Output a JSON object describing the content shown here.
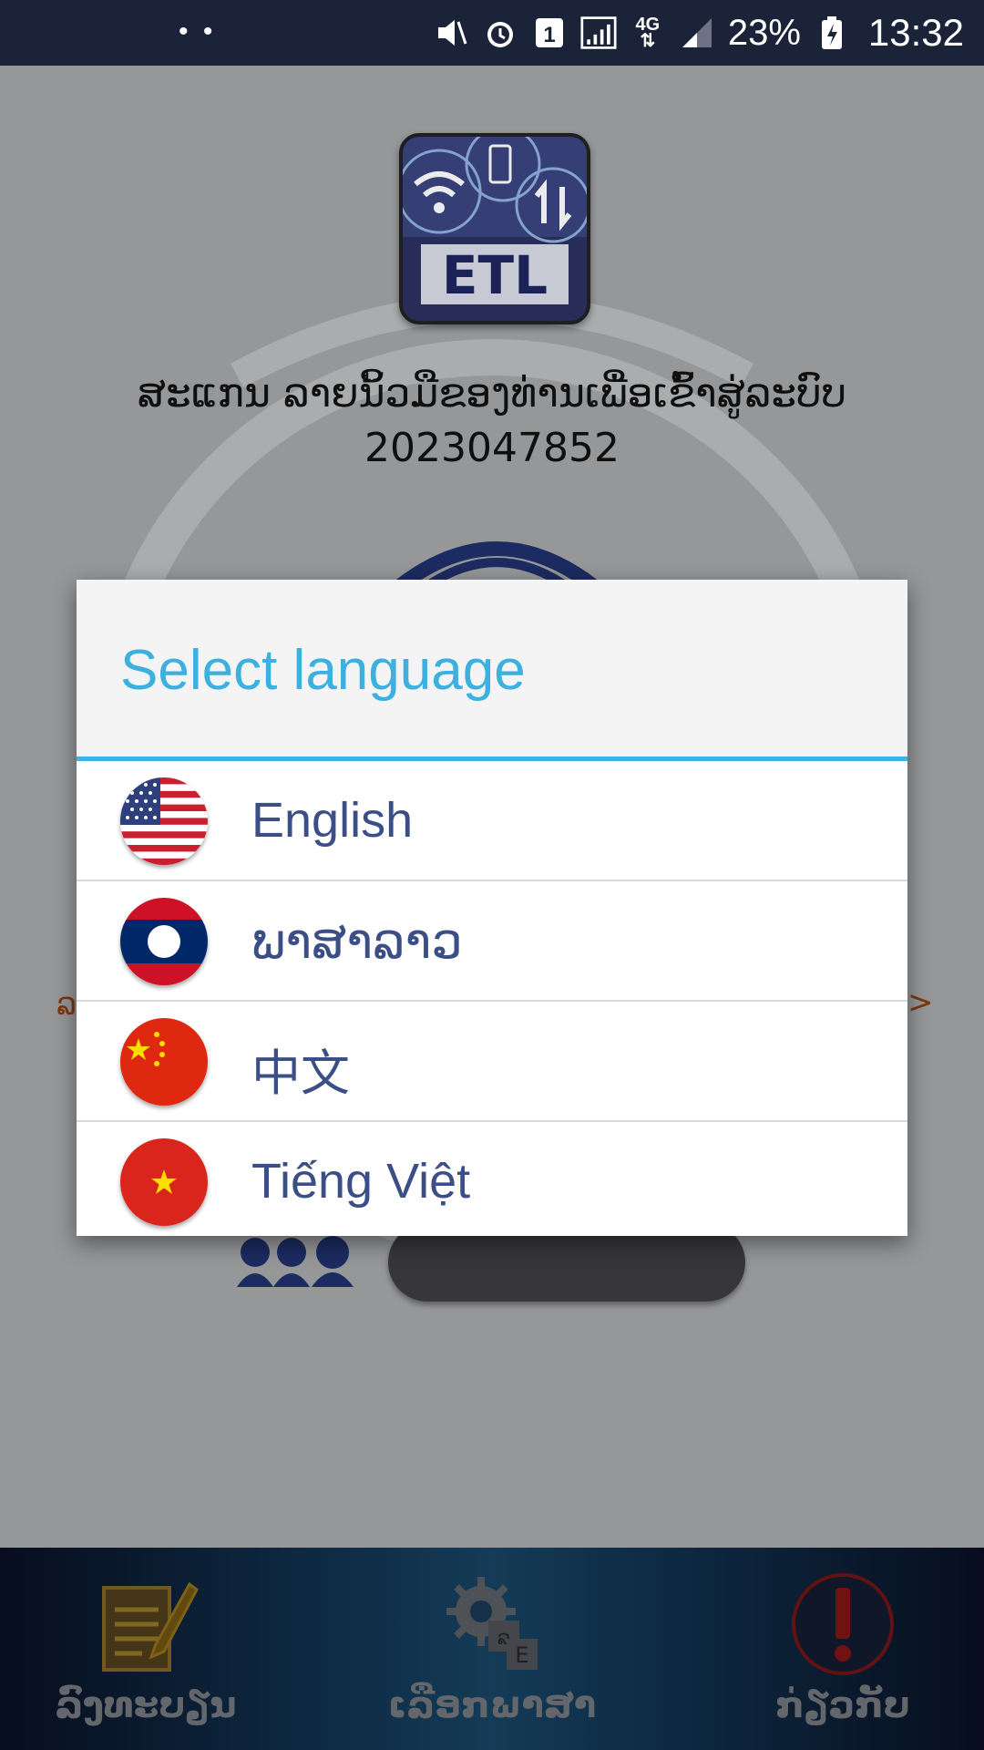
{
  "status_bar": {
    "dots": "• •",
    "battery_percent": "23%",
    "time": "13:32",
    "sim_slot": "1",
    "network": "4G"
  },
  "app": {
    "logo_text": "ETL",
    "scan_instruction": "ສະແກນ ລາຍນິ້ວມືຂອງທ່ານເພື່ອເຂົ້າສູ່ລະບົບ",
    "account_number": "2023047852",
    "left_arrow": "ລ",
    "right_arrow": ">"
  },
  "dialog": {
    "title": "Select language",
    "languages": [
      {
        "label": "English",
        "flag": "us-flag"
      },
      {
        "label": "ພາສາລາວ",
        "flag": "laos-flag"
      },
      {
        "label": "中文",
        "flag": "china-flag"
      },
      {
        "label": "Tiếng Việt",
        "flag": "vietnam-flag"
      }
    ]
  },
  "bottom_nav": {
    "items": [
      {
        "label": "ລົງທະບຽນ",
        "icon": "register-icon"
      },
      {
        "label": "ເລືອກພາສາ",
        "icon": "language-settings-icon"
      },
      {
        "label": "ກ່ຽວກັບ",
        "icon": "about-icon"
      }
    ]
  },
  "colors": {
    "accent": "#3cb0de",
    "language_text": "#3b4f86",
    "status_bar": "#1b2338"
  }
}
